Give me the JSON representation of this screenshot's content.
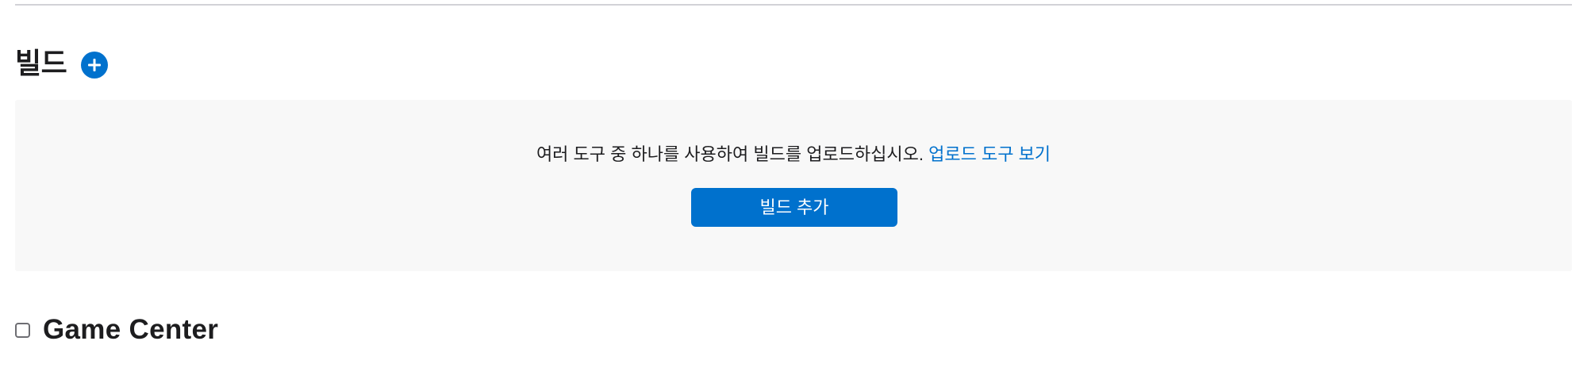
{
  "builds_section": {
    "title": "빌드",
    "add_icon": "plus-circle-icon",
    "empty_state": {
      "message": "여러 도구 중 하나를 사용하여 빌드를 업로드하십시오.",
      "link_label": "업로드 도구 보기",
      "button_label": "빌드 추가"
    }
  },
  "game_center": {
    "title": "Game Center",
    "checked": false
  },
  "colors": {
    "accent": "#0071cd",
    "panel_background": "#f8f8f8",
    "divider": "#d2d2d7",
    "text": "#1d1d1f"
  }
}
